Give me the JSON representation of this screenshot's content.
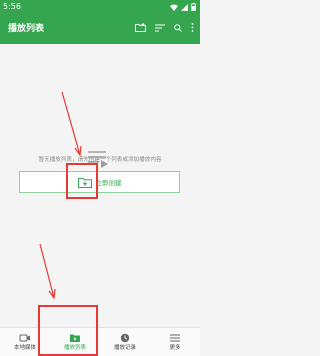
{
  "status_bar": {
    "time": "5:56"
  },
  "app_bar": {
    "title": "播放列表"
  },
  "empty_state": {
    "message": "暂无播放列表，请先创建一个列表或添加播放内容",
    "create_button_label": "立即创建"
  },
  "bottom_nav": {
    "items": [
      {
        "label": "本地媒体",
        "icon": "video-icon"
      },
      {
        "label": "播放列表",
        "icon": "playlist-folder-icon"
      },
      {
        "label": "播放记录",
        "icon": "history-icon"
      },
      {
        "label": "更多",
        "icon": "menu-icon"
      }
    ],
    "active_index": 1
  },
  "colors": {
    "brand_green": "#36a54f",
    "annotation_red": "#e53935"
  }
}
